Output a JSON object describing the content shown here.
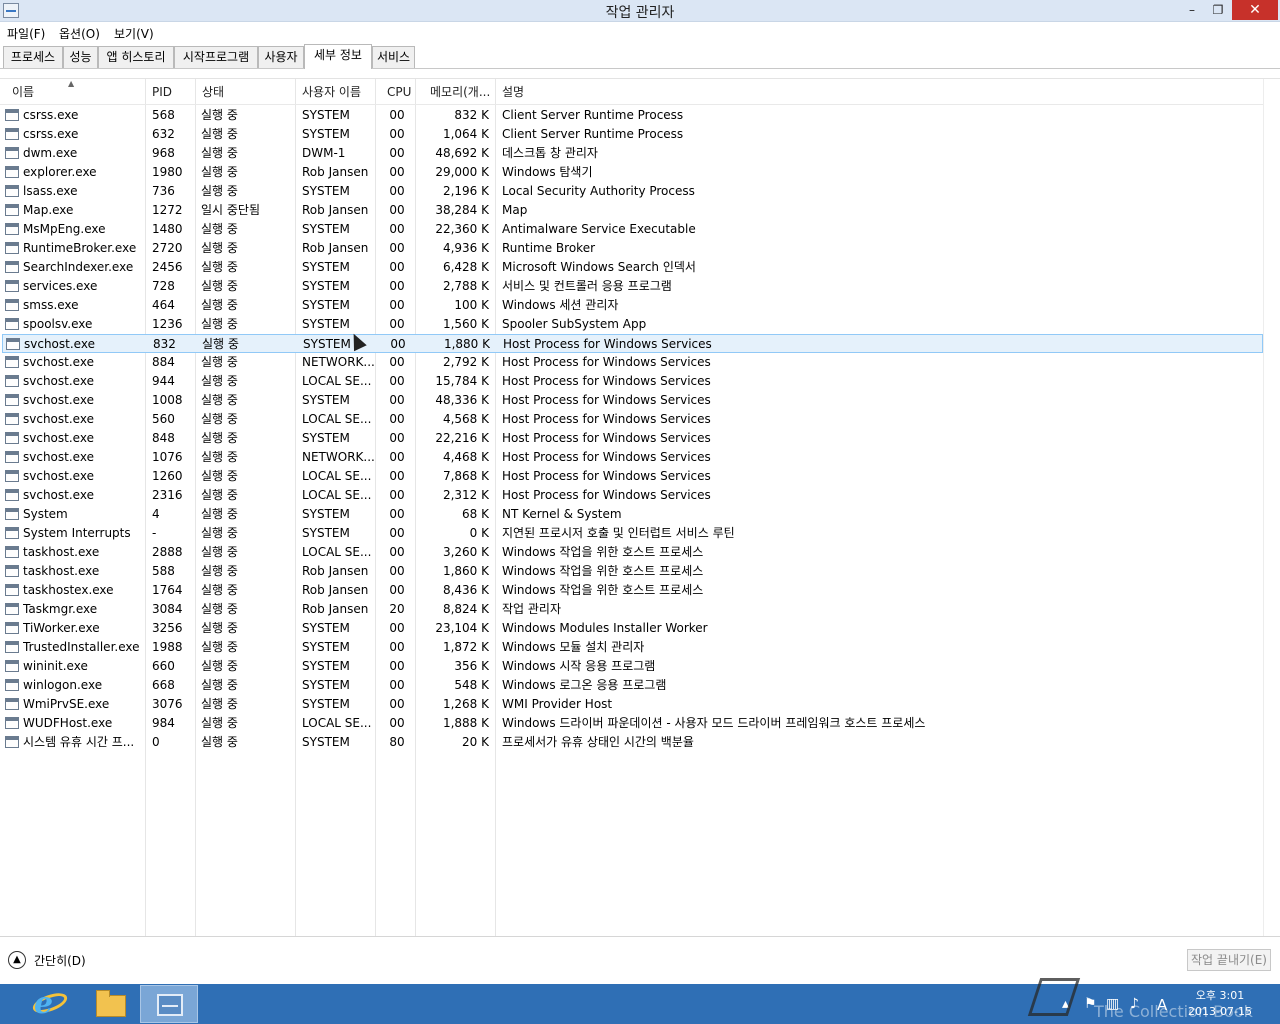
{
  "window": {
    "title": "작업 관리자",
    "min": "–",
    "max": "❐",
    "close": "✕"
  },
  "menu": [
    "파일(F)",
    "옵션(O)",
    "보기(V)"
  ],
  "tabs": [
    "프로세스",
    "성능",
    "앱 히스토리",
    "시작프로그램",
    "사용자",
    "세부 정보",
    "서비스"
  ],
  "active_tab": "세부 정보",
  "columns": [
    "이름",
    "PID",
    "상태",
    "사용자 이름",
    "CPU",
    "메모리(개...",
    "설명"
  ],
  "rows": [
    {
      "name": "csrss.exe",
      "pid": "568",
      "status": "실행 중",
      "user": "SYSTEM",
      "cpu": "00",
      "mem": "832 K",
      "desc": "Client Server Runtime Process"
    },
    {
      "name": "csrss.exe",
      "pid": "632",
      "status": "실행 중",
      "user": "SYSTEM",
      "cpu": "00",
      "mem": "1,064 K",
      "desc": "Client Server Runtime Process"
    },
    {
      "name": "dwm.exe",
      "pid": "968",
      "status": "실행 중",
      "user": "DWM-1",
      "cpu": "00",
      "mem": "48,692 K",
      "desc": "데스크톱 창 관리자"
    },
    {
      "name": "explorer.exe",
      "pid": "1980",
      "status": "실행 중",
      "user": "Rob Jansen",
      "cpu": "00",
      "mem": "29,000 K",
      "desc": "Windows 탐색기"
    },
    {
      "name": "lsass.exe",
      "pid": "736",
      "status": "실행 중",
      "user": "SYSTEM",
      "cpu": "00",
      "mem": "2,196 K",
      "desc": "Local Security Authority Process"
    },
    {
      "name": "Map.exe",
      "pid": "1272",
      "status": "일시 중단됨",
      "user": "Rob Jansen",
      "cpu": "00",
      "mem": "38,284 K",
      "desc": "Map"
    },
    {
      "name": "MsMpEng.exe",
      "pid": "1480",
      "status": "실행 중",
      "user": "SYSTEM",
      "cpu": "00",
      "mem": "22,360 K",
      "desc": "Antimalware Service Executable"
    },
    {
      "name": "RuntimeBroker.exe",
      "pid": "2720",
      "status": "실행 중",
      "user": "Rob Jansen",
      "cpu": "00",
      "mem": "4,936 K",
      "desc": "Runtime Broker"
    },
    {
      "name": "SearchIndexer.exe",
      "pid": "2456",
      "status": "실행 중",
      "user": "SYSTEM",
      "cpu": "00",
      "mem": "6,428 K",
      "desc": "Microsoft Windows Search 인덱서"
    },
    {
      "name": "services.exe",
      "pid": "728",
      "status": "실행 중",
      "user": "SYSTEM",
      "cpu": "00",
      "mem": "2,788 K",
      "desc": "서비스 및 컨트롤러 응용 프로그램"
    },
    {
      "name": "smss.exe",
      "pid": "464",
      "status": "실행 중",
      "user": "SYSTEM",
      "cpu": "00",
      "mem": "100 K",
      "desc": "Windows 세션 관리자"
    },
    {
      "name": "spoolsv.exe",
      "pid": "1236",
      "status": "실행 중",
      "user": "SYSTEM",
      "cpu": "00",
      "mem": "1,560 K",
      "desc": "Spooler SubSystem App"
    },
    {
      "name": "svchost.exe",
      "pid": "832",
      "status": "실행 중",
      "user": "SYSTEM",
      "cpu": "00",
      "mem": "1,880 K",
      "desc": "Host Process for Windows Services",
      "selected": true
    },
    {
      "name": "svchost.exe",
      "pid": "884",
      "status": "실행 중",
      "user": "NETWORK...",
      "cpu": "00",
      "mem": "2,792 K",
      "desc": "Host Process for Windows Services"
    },
    {
      "name": "svchost.exe",
      "pid": "944",
      "status": "실행 중",
      "user": "LOCAL SE...",
      "cpu": "00",
      "mem": "15,784 K",
      "desc": "Host Process for Windows Services"
    },
    {
      "name": "svchost.exe",
      "pid": "1008",
      "status": "실행 중",
      "user": "SYSTEM",
      "cpu": "00",
      "mem": "48,336 K",
      "desc": "Host Process for Windows Services"
    },
    {
      "name": "svchost.exe",
      "pid": "560",
      "status": "실행 중",
      "user": "LOCAL SE...",
      "cpu": "00",
      "mem": "4,568 K",
      "desc": "Host Process for Windows Services"
    },
    {
      "name": "svchost.exe",
      "pid": "848",
      "status": "실행 중",
      "user": "SYSTEM",
      "cpu": "00",
      "mem": "22,216 K",
      "desc": "Host Process for Windows Services"
    },
    {
      "name": "svchost.exe",
      "pid": "1076",
      "status": "실행 중",
      "user": "NETWORK...",
      "cpu": "00",
      "mem": "4,468 K",
      "desc": "Host Process for Windows Services"
    },
    {
      "name": "svchost.exe",
      "pid": "1260",
      "status": "실행 중",
      "user": "LOCAL SE...",
      "cpu": "00",
      "mem": "7,868 K",
      "desc": "Host Process for Windows Services"
    },
    {
      "name": "svchost.exe",
      "pid": "2316",
      "status": "실행 중",
      "user": "LOCAL SE...",
      "cpu": "00",
      "mem": "2,312 K",
      "desc": "Host Process for Windows Services"
    },
    {
      "name": "System",
      "pid": "4",
      "status": "실행 중",
      "user": "SYSTEM",
      "cpu": "00",
      "mem": "68 K",
      "desc": "NT Kernel & System"
    },
    {
      "name": "System Interrupts",
      "pid": "-",
      "status": "실행 중",
      "user": "SYSTEM",
      "cpu": "00",
      "mem": "0 K",
      "desc": "지연된 프로시저 호출 및 인터럽트 서비스 루틴"
    },
    {
      "name": "taskhost.exe",
      "pid": "2888",
      "status": "실행 중",
      "user": "LOCAL SE...",
      "cpu": "00",
      "mem": "3,260 K",
      "desc": "Windows 작업을 위한 호스트 프로세스"
    },
    {
      "name": "taskhost.exe",
      "pid": "588",
      "status": "실행 중",
      "user": "Rob Jansen",
      "cpu": "00",
      "mem": "1,860 K",
      "desc": "Windows 작업을 위한 호스트 프로세스"
    },
    {
      "name": "taskhostex.exe",
      "pid": "1764",
      "status": "실행 중",
      "user": "Rob Jansen",
      "cpu": "00",
      "mem": "8,436 K",
      "desc": "Windows 작업을 위한 호스트 프로세스"
    },
    {
      "name": "Taskmgr.exe",
      "pid": "3084",
      "status": "실행 중",
      "user": "Rob Jansen",
      "cpu": "20",
      "mem": "8,824 K",
      "desc": "작업 관리자"
    },
    {
      "name": "TiWorker.exe",
      "pid": "3256",
      "status": "실행 중",
      "user": "SYSTEM",
      "cpu": "00",
      "mem": "23,104 K",
      "desc": "Windows Modules Installer Worker"
    },
    {
      "name": "TrustedInstaller.exe",
      "pid": "1988",
      "status": "실행 중",
      "user": "SYSTEM",
      "cpu": "00",
      "mem": "1,872 K",
      "desc": "Windows 모듈 설치 관리자"
    },
    {
      "name": "wininit.exe",
      "pid": "660",
      "status": "실행 중",
      "user": "SYSTEM",
      "cpu": "00",
      "mem": "356 K",
      "desc": "Windows 시작 응용 프로그램"
    },
    {
      "name": "winlogon.exe",
      "pid": "668",
      "status": "실행 중",
      "user": "SYSTEM",
      "cpu": "00",
      "mem": "548 K",
      "desc": "Windows 로그온 응용 프로그램"
    },
    {
      "name": "WmiPrvSE.exe",
      "pid": "3076",
      "status": "실행 중",
      "user": "SYSTEM",
      "cpu": "00",
      "mem": "1,268 K",
      "desc": "WMI Provider Host"
    },
    {
      "name": "WUDFHost.exe",
      "pid": "984",
      "status": "실행 중",
      "user": "LOCAL SE...",
      "cpu": "00",
      "mem": "1,888 K",
      "desc": "Windows 드라이버 파운데이션 - 사용자 모드 드라이버 프레임워크 호스트 프로세스"
    },
    {
      "name": "시스템 유휴 시간 프...",
      "pid": "0",
      "status": "실행 중",
      "user": "SYSTEM",
      "cpu": "80",
      "mem": "20 K",
      "desc": "프로세서가 유휴 상태인 시간의 백분율"
    }
  ],
  "footer": {
    "fewer_details": "간단히(D)",
    "end_task": "작업 끝내기(E)"
  },
  "taskbar": {
    "apps": [
      "internet-explorer-icon",
      "file-explorer-icon",
      "task-manager-icon"
    ],
    "clock_time": "오후 3:01",
    "clock_date": "2013-07-15",
    "ime": "A",
    "watermark": "The Collection Book"
  },
  "colors": {
    "titlebar": "#dbe6f4",
    "selected_row": "#e5f1fb",
    "selected_border": "#91c9f7",
    "taskbar": "#2f6fb5",
    "close": "#c7312a"
  }
}
